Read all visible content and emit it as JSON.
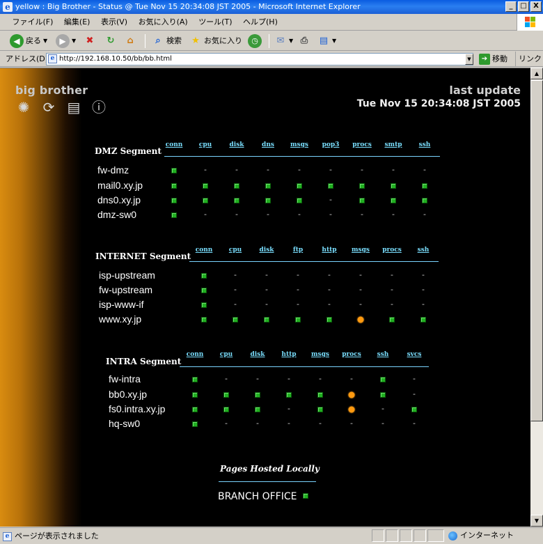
{
  "window": {
    "title": "yellow : Big Brother - Status @ Tue Nov 15 20:34:08 JST 2005 - Microsoft Internet Explorer",
    "minimize": "_",
    "maximize": "□",
    "close": "X"
  },
  "menu": [
    "ファイル(F)",
    "編集(E)",
    "表示(V)",
    "お気に入り(A)",
    "ツール(T)",
    "ヘルプ(H)"
  ],
  "toolbar": {
    "back_label": "戻る",
    "search_label": "検索",
    "favorites_label": "お気に入り"
  },
  "address": {
    "label": "アドレス(D)",
    "url": "http://192.168.10.50/bb/bb.html",
    "go_label": "移動",
    "links_label": "リンク"
  },
  "page": {
    "brand": "big brother",
    "last_update_label": "last update",
    "last_update_time": "Tue Nov 15 20:34:08 JST 2005",
    "segments": [
      {
        "name": "DMZ Segment",
        "columns": [
          "conn",
          "cpu",
          "disk",
          "dns",
          "msgs",
          "pop3",
          "procs",
          "smtp",
          "ssh"
        ],
        "hosts": [
          {
            "name": "fw-dmz",
            "status": [
              "green",
              "-",
              "-",
              "-",
              "-",
              "-",
              "-",
              "-",
              "-"
            ]
          },
          {
            "name": "mail0.xy.jp",
            "status": [
              "green",
              "green",
              "green",
              "green",
              "green",
              "green",
              "green",
              "green",
              "green"
            ]
          },
          {
            "name": "dns0.xy.jp",
            "status": [
              "green",
              "green",
              "green",
              "green",
              "green",
              "-",
              "green",
              "green",
              "green"
            ]
          },
          {
            "name": "dmz-sw0",
            "status": [
              "green",
              "-",
              "-",
              "-",
              "-",
              "-",
              "-",
              "-",
              "-"
            ]
          }
        ]
      },
      {
        "name": "INTERNET Segment",
        "columns": [
          "conn",
          "cpu",
          "disk",
          "ftp",
          "http",
          "msgs",
          "procs",
          "ssh"
        ],
        "hosts": [
          {
            "name": "isp-upstream",
            "status": [
              "green",
              "-",
              "-",
              "-",
              "-",
              "-",
              "-",
              "-"
            ]
          },
          {
            "name": "fw-upstream",
            "status": [
              "green",
              "-",
              "-",
              "-",
              "-",
              "-",
              "-",
              "-"
            ]
          },
          {
            "name": "isp-www-if",
            "status": [
              "green",
              "-",
              "-",
              "-",
              "-",
              "-",
              "-",
              "-"
            ]
          },
          {
            "name": "www.xy.jp",
            "status": [
              "green",
              "green",
              "green",
              "green",
              "green",
              "yellow",
              "green",
              "green"
            ]
          }
        ]
      },
      {
        "name": "INTRA Segment",
        "columns": [
          "conn",
          "cpu",
          "disk",
          "http",
          "msgs",
          "procs",
          "ssh",
          "svcs"
        ],
        "hosts": [
          {
            "name": "fw-intra",
            "status": [
              "green",
              "-",
              "-",
              "-",
              "-",
              "-",
              "green",
              "-"
            ]
          },
          {
            "name": "bb0.xy.jp",
            "status": [
              "green",
              "green",
              "green",
              "green",
              "green",
              "yellow",
              "green",
              "-"
            ]
          },
          {
            "name": "fs0.intra.xy.jp",
            "status": [
              "green",
              "green",
              "green",
              "-",
              "green",
              "yellow",
              "-",
              "green"
            ]
          },
          {
            "name": "hq-sw0",
            "status": [
              "green",
              "-",
              "-",
              "-",
              "-",
              "-",
              "-",
              "-"
            ]
          }
        ]
      }
    ],
    "hosted_title": "Pages Hosted Locally",
    "branch_label": "BRANCH OFFICE",
    "branch_status": "green"
  },
  "status": {
    "text": "ページが表示されました",
    "zone": "インターネット"
  },
  "colors": {
    "green": "#22b022",
    "yellow": "#ff9a10",
    "header_cyan": "#7adfff"
  }
}
